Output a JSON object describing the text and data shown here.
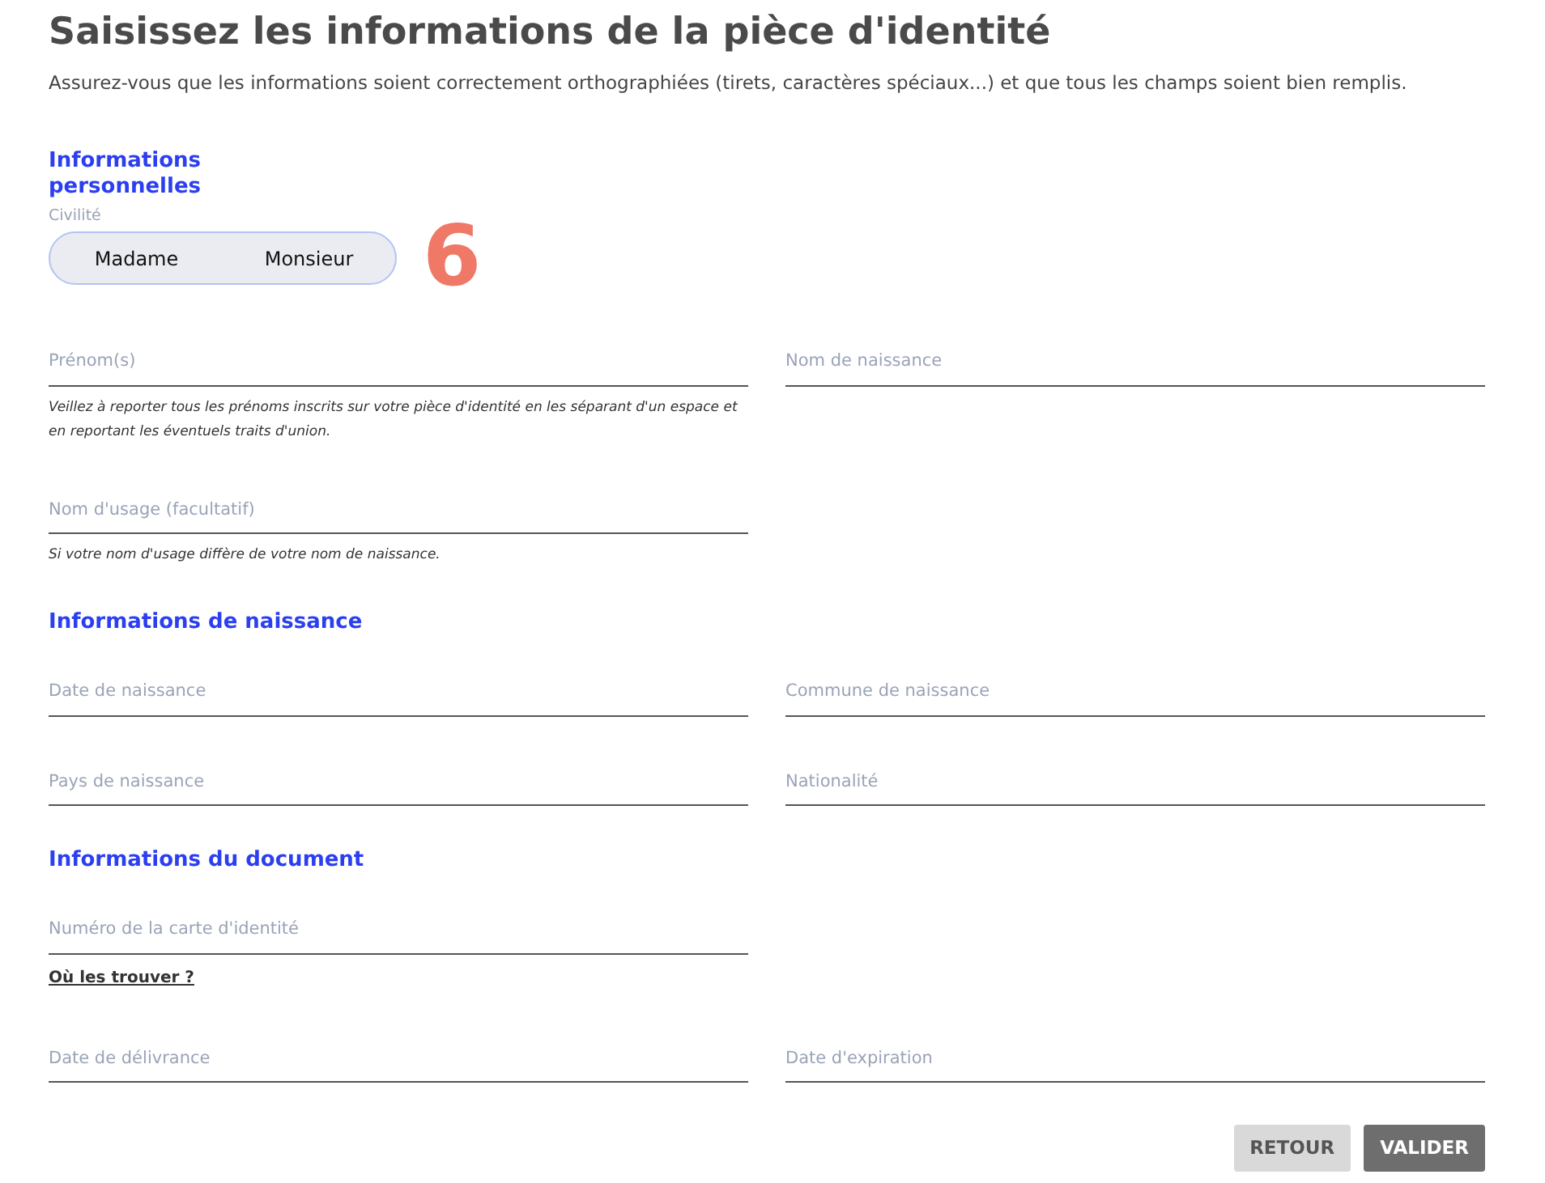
{
  "title": "Saisissez les informations de la pièce d'identité",
  "subtitle": "Assurez-vous que les informations soient correctement orthographiées (tirets, caractères spéciaux...) et que tous les champs soient bien remplis.",
  "sections": [
    {
      "heading": "Informations personnelles",
      "civility": {
        "label": "Civilité",
        "options": [
          {
            "label": "Madame",
            "selected": false
          },
          {
            "label": "Monsieur",
            "selected": false
          }
        ]
      },
      "step_number": "6",
      "rows": [
        [
          {
            "placeholder": "Prénom(s)",
            "help": "Veillez à reporter tous les prénoms inscrits sur votre pièce d'identité en les séparant d'un espace et en reportant les éventuels traits d'union."
          },
          {
            "placeholder": "Nom de naissance"
          }
        ],
        [
          {
            "placeholder": "Nom d'usage (facultatif)",
            "help": "Si votre nom d'usage diffère de votre nom de naissance."
          }
        ]
      ]
    },
    {
      "heading": "Informations de naissance",
      "rows": [
        [
          {
            "placeholder": "Date de naissance"
          },
          {
            "placeholder": "Commune de naissance"
          }
        ],
        [
          {
            "placeholder": "Pays de naissance"
          },
          {
            "placeholder": "Nationalité"
          }
        ]
      ]
    },
    {
      "heading": "Informations du document",
      "rows": [
        [
          {
            "placeholder": "Numéro de la carte d'identité",
            "link": "Où les trouver ?"
          }
        ],
        [
          {
            "placeholder": "Date de délivrance"
          },
          {
            "placeholder": "Date d'expiration"
          }
        ]
      ]
    }
  ],
  "buttons": [
    {
      "label": "RETOUR",
      "kind": "secondary"
    },
    {
      "label": "VALIDER",
      "kind": "primary"
    }
  ]
}
